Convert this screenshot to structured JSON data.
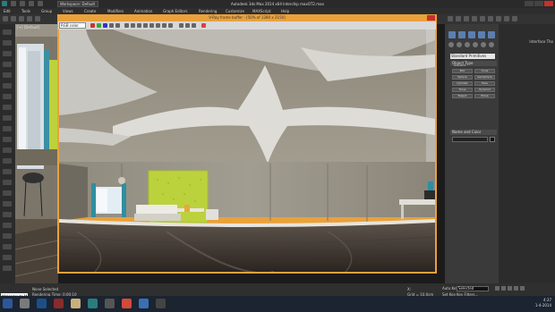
{
  "app": {
    "title": "Autodesk 3ds Max 2014 x64      Interchip maxOT2.max",
    "workspace": "Workspace: Default"
  },
  "menu": [
    "Edit",
    "Tools",
    "Group",
    "Views",
    "Create",
    "Modifiers",
    "Animation",
    "Graph Editors",
    "Rendering",
    "Customize",
    "MAXScript",
    "Help"
  ],
  "viewport": {
    "label": "[+] [Default]"
  },
  "frame_buffer": {
    "title": "V-Ray frame buffer - [50% of 1280 x 2150]",
    "channel": "RGB color"
  },
  "command_panel": {
    "side_label": "Interface Tho",
    "primitive_dropdown": "Standard Primitives",
    "object_type_header": "Object Type",
    "autogrid_label": "AutoGrid",
    "buttons": [
      "Box",
      "Cone",
      "Sphere",
      "GeoSphere",
      "Cylinder",
      "Tube",
      "Torus",
      "Pyramid",
      "Teapot",
      "Plane"
    ],
    "name_color_header": "Name and Color"
  },
  "status_bar": {
    "maxscript": "Welcome to M",
    "line1": "None Selected",
    "line2": "Rendering Time: 0:00:10",
    "coord_x": "X:",
    "coord_y": "Y:",
    "grid": "Grid = 10.0cm",
    "autokey": "Auto Key",
    "setkey": "Set Key",
    "selected": "Selected",
    "key_filters": "Key Filters..."
  },
  "taskbar": {
    "time": "4:37",
    "date": "1-4-2014"
  },
  "colors": {
    "frame_buffer_border": "#e9a13b",
    "accent_wall": "#bcd23c",
    "close_button": "#c8302c"
  }
}
